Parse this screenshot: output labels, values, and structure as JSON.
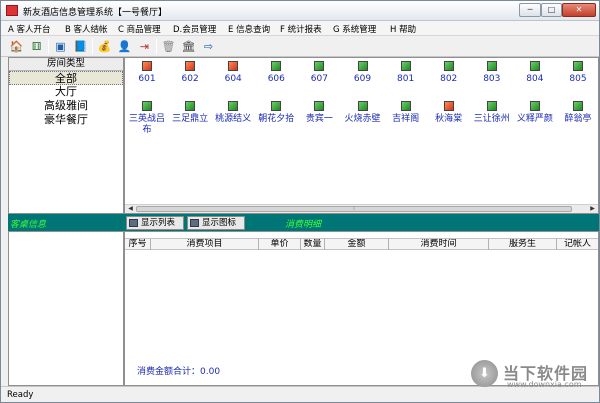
{
  "window": {
    "title": "新友酒店信息管理系统【一号餐厅】",
    "controls": {
      "minimize": "─",
      "maximize": "□",
      "close": "✕"
    }
  },
  "menu": [
    "A 客人开台",
    "B 客人结帐",
    "C 商品管理",
    "D.会员管理",
    "E 信息查询",
    "F 统计报表",
    "G 系统管理",
    "H 帮助"
  ],
  "toolbar": {
    "icons": [
      {
        "name": "open-table-icon",
        "glyph": "🏠",
        "color": "#c0392b"
      },
      {
        "name": "tables-icon",
        "glyph": "⚅",
        "color": "#2f7a3a"
      },
      {
        "name": "monitor-icon",
        "glyph": "▣",
        "color": "#1d5ea8"
      },
      {
        "name": "book-icon",
        "glyph": "📘",
        "color": "#7a2a8a"
      },
      {
        "name": "money-bag-icon",
        "glyph": "💰",
        "color": "#2d8a2d"
      },
      {
        "name": "member-icon",
        "glyph": "👤",
        "color": "#333333"
      },
      {
        "name": "logout-icon",
        "glyph": "⇥",
        "color": "#b33333"
      },
      {
        "name": "trash-icon",
        "glyph": "🗑",
        "color": "#888888"
      },
      {
        "name": "bank-icon",
        "glyph": "🏛",
        "color": "#444444"
      },
      {
        "name": "exit-icon",
        "glyph": "⇨",
        "color": "#1d5ea8"
      }
    ]
  },
  "room_types": {
    "header": "房间类型",
    "items": [
      {
        "label": "全部",
        "selected": true
      },
      {
        "label": "大厅",
        "selected": false
      },
      {
        "label": "高级雅间",
        "selected": false
      },
      {
        "label": "豪华餐厅",
        "selected": false
      }
    ]
  },
  "rooms": [
    {
      "label": "601",
      "status": "occupied"
    },
    {
      "label": "602",
      "status": "occupied"
    },
    {
      "label": "604",
      "status": "occupied"
    },
    {
      "label": "606",
      "status": "free"
    },
    {
      "label": "607",
      "status": "free"
    },
    {
      "label": "609",
      "status": "free"
    },
    {
      "label": "801",
      "status": "free"
    },
    {
      "label": "802",
      "status": "free"
    },
    {
      "label": "803",
      "status": "free"
    },
    {
      "label": "804",
      "status": "free"
    },
    {
      "label": "805",
      "status": "free"
    },
    {
      "label": "三英战吕布",
      "status": "free"
    },
    {
      "label": "三足鼎立",
      "status": "free"
    },
    {
      "label": "桃源结义",
      "status": "free"
    },
    {
      "label": "朝花夕拾",
      "status": "free"
    },
    {
      "label": "贵宾一",
      "status": "free"
    },
    {
      "label": "火烧赤壁",
      "status": "free"
    },
    {
      "label": "吉祥阁",
      "status": "free"
    },
    {
      "label": "秋海棠",
      "status": "occupied"
    },
    {
      "label": "三让徐州",
      "status": "free"
    },
    {
      "label": "义释严颜",
      "status": "free"
    },
    {
      "label": "醉翁亭",
      "status": "free"
    }
  ],
  "colors": {
    "room_free": "#2a9a2a",
    "room_occupied": "#e0481f",
    "section_bar": "#007575",
    "section_text": "#3bff3b",
    "link_blue": "#1a2bb5"
  },
  "view_buttons": {
    "list": "显示列表",
    "icons": "显示图标"
  },
  "customer_info": {
    "title": "客桌信息"
  },
  "consumption": {
    "title": "消费明细",
    "columns": [
      "序号",
      "消费项目",
      "单价",
      "数量",
      "金额",
      "消费时间",
      "服务生",
      "记帐人"
    ],
    "rows": [],
    "total_label": "消费金额合计：0.00"
  },
  "statusbar": {
    "text": "Ready"
  },
  "watermark": {
    "title": "当下软件园",
    "url": "www.downxia.com",
    "glyph": "⬇"
  }
}
